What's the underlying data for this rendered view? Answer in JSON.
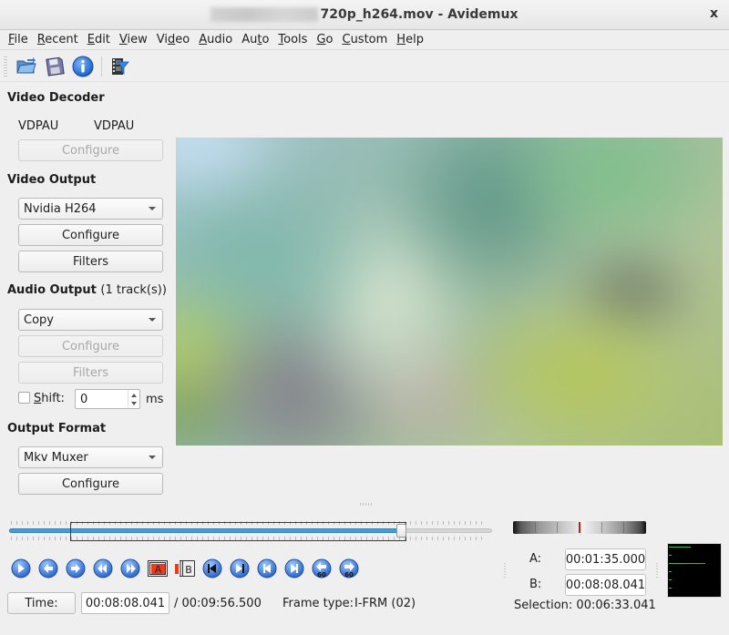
{
  "window": {
    "title_visible_suffix": "720p_h264.mov - Avidemux",
    "close_label": "x"
  },
  "menu": [
    {
      "label": "File",
      "mnemonic": "F",
      "rest": "ile"
    },
    {
      "label": "Recent",
      "mnemonic": "R",
      "rest": "ecent"
    },
    {
      "label": "Edit",
      "mnemonic": "E",
      "rest": "dit"
    },
    {
      "label": "View",
      "mnemonic": "V",
      "rest": "iew"
    },
    {
      "label": "Video",
      "pre": "Vi",
      "mnemonic": "d",
      "rest": "eo"
    },
    {
      "label": "Audio",
      "mnemonic": "A",
      "rest": "udio"
    },
    {
      "label": "Auto",
      "pre": "Au",
      "mnemonic": "t",
      "rest": "o"
    },
    {
      "label": "Tools",
      "mnemonic": "T",
      "rest": "ools"
    },
    {
      "label": "Go",
      "mnemonic": "G",
      "rest": "o"
    },
    {
      "label": "Custom",
      "mnemonic": "C",
      "rest": "ustom"
    },
    {
      "label": "Help",
      "mnemonic": "H",
      "rest": "elp"
    }
  ],
  "toolbar": {
    "icons": [
      "open-file-icon",
      "save-file-icon",
      "info-icon",
      "filters-icon"
    ]
  },
  "video_decoder": {
    "title": "Video Decoder",
    "decoder_left": "VDPAU",
    "decoder_right": "VDPAU",
    "configure_label": "Configure"
  },
  "video_output": {
    "title": "Video Output",
    "codec_selected": "Nvidia H264",
    "configure_label": "Configure",
    "filters_label": "Filters"
  },
  "audio_output": {
    "title": "Audio Output",
    "tracks": "(1 track(s))",
    "codec_selected": "Copy",
    "configure_label": "Configure",
    "filters_label": "Filters",
    "shift_label_mnemonic": "S",
    "shift_label_rest": "hift:",
    "shift_checked": false,
    "shift_value": "0",
    "shift_unit": "ms"
  },
  "output_format": {
    "title": "Output Format",
    "muxer_selected": "Mkv Muxer",
    "configure_label": "Configure"
  },
  "timeline": {
    "position_fraction": 0.8195,
    "selection_start_fraction": 0.159,
    "selection_end_fraction": 0.8195
  },
  "navigation": {
    "buttons": [
      "play-icon",
      "previous-frame-icon",
      "next-frame-icon",
      "previous-keyframe-icon",
      "next-keyframe-icon",
      "set-marker-a-icon",
      "set-marker-b-icon",
      "go-to-start-icon",
      "go-to-end-icon",
      "go-to-marker-a-icon",
      "go-to-marker-b-icon",
      "back-60s-icon",
      "forward-60s-icon"
    ],
    "marker_a_label": "A",
    "marker_b_label": "B",
    "back60_label": "60",
    "forward60_label": "60"
  },
  "time": {
    "button_label": "Time:",
    "current": "00:08:08.041",
    "total": "/ 00:09:56.500",
    "frame_type_label": "Frame type:",
    "frame_type_value": "I-FRM (02)"
  },
  "markers": {
    "a_label": "A:",
    "a_value": "00:01:35.000",
    "b_label": "B:",
    "b_value": "00:08:08.041",
    "selection_text": "Selection: 00:06:33.041"
  },
  "colors": {
    "accent_blue": "#4a9bd3",
    "selection_border": "#2a2ad0",
    "jog_marker": "#c41a1a",
    "meter_green": "#3fbf3f"
  }
}
